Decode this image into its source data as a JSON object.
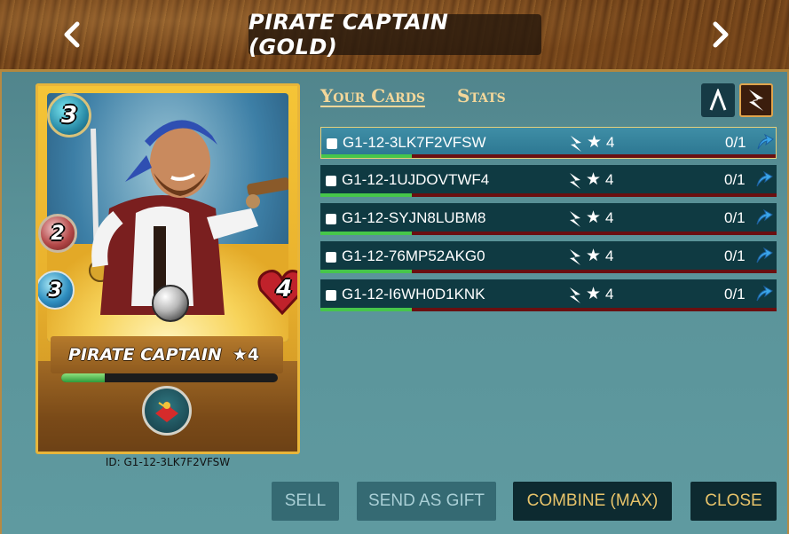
{
  "header": {
    "title": "PIRATE CAPTAIN (GOLD)",
    "prev_icon": "chevron-left-icon",
    "next_icon": "chevron-right-icon"
  },
  "card": {
    "name": "PIRATE CAPTAIN",
    "level": "★4",
    "mana": "3",
    "attack": "2",
    "speed": "3",
    "health": "4",
    "xp_fraction": 0.2,
    "id_label": "ID: G1-12-3LK7F2VFSW",
    "ability_icon": "ability-icon"
  },
  "tabs": {
    "your_cards": "Your Cards",
    "stats": "Stats"
  },
  "sort": {
    "up_icon": "chevron-up-icon",
    "edition_icon": "edition-icon"
  },
  "rows": [
    {
      "id": "G1-12-3LK7F2VFSW",
      "level": "4",
      "count": "0/1",
      "xp_fraction": 0.2,
      "selected": true
    },
    {
      "id": "G1-12-1UJDOVTWF4",
      "level": "4",
      "count": "0/1",
      "xp_fraction": 0.2,
      "selected": false
    },
    {
      "id": "G1-12-SYJN8LUBM8",
      "level": "4",
      "count": "0/1",
      "xp_fraction": 0.2,
      "selected": false
    },
    {
      "id": "G1-12-76MP52AKG0",
      "level": "4",
      "count": "0/1",
      "xp_fraction": 0.2,
      "selected": false
    },
    {
      "id": "G1-12-I6WH0D1KNK",
      "level": "4",
      "count": "0/1",
      "xp_fraction": 0.2,
      "selected": false
    }
  ],
  "buttons": {
    "sell": "SELL",
    "gift": "SEND AS GIFT",
    "combine": "COMBINE (MAX)",
    "close": "CLOSE"
  },
  "colors": {
    "accent_gold": "#e7c36a",
    "panel_teal": "#0f3a42",
    "xp_green": "#46c64a",
    "xp_red": "#6a0f10"
  }
}
